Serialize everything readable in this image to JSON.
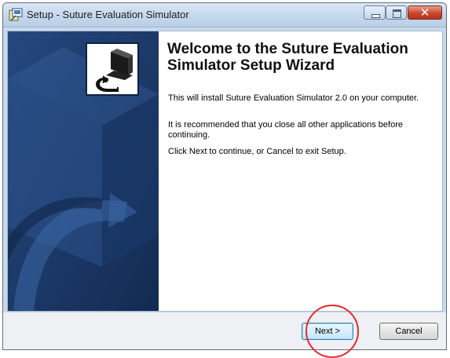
{
  "window": {
    "title": "Setup - Suture Evaluation Simulator"
  },
  "wizard": {
    "heading": "Welcome to the Suture Evaluation Simulator Setup Wizard",
    "paragraphs": [
      "This will install Suture Evaluation Simulator 2.0 on your computer.",
      "It is recommended that you close all other applications before continuing.",
      "Click Next to continue, or Cancel to exit Setup."
    ]
  },
  "buttons": {
    "next_label": "Next >",
    "cancel_label": "Cancel"
  },
  "icons": {
    "app": "installer-app-icon",
    "side_graphic": "computer-install-icon"
  },
  "colors": {
    "side_panel": "#1c3a6b",
    "annotation_circle": "#e8282e"
  }
}
